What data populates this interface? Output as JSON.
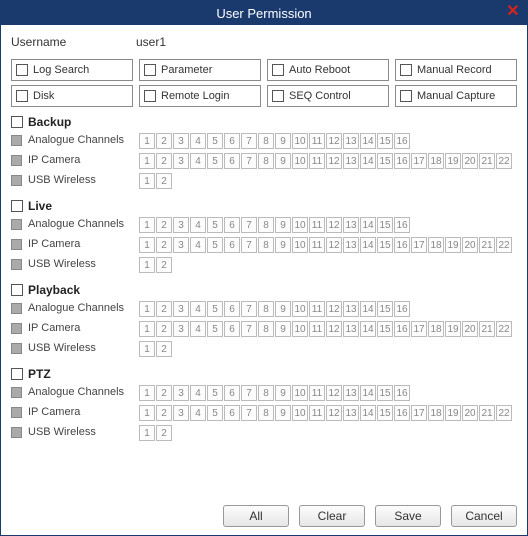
{
  "title": "User Permission",
  "username_label": "Username",
  "username_value": "user1",
  "perm_row1": [
    {
      "key": "log_search",
      "label": "Log Search"
    },
    {
      "key": "parameter",
      "label": "Parameter"
    },
    {
      "key": "auto_reboot",
      "label": "Auto Reboot"
    },
    {
      "key": "manual_record",
      "label": "Manual Record"
    }
  ],
  "perm_row2": [
    {
      "key": "disk",
      "label": "Disk"
    },
    {
      "key": "remote_login",
      "label": "Remote Login"
    },
    {
      "key": "seq_control",
      "label": "SEQ Control"
    },
    {
      "key": "manual_capture",
      "label": "Manual Capture"
    }
  ],
  "sections": [
    {
      "key": "backup",
      "title": "Backup",
      "rows": [
        {
          "key": "analogue",
          "label": "Analogue Channels",
          "count": 16
        },
        {
          "key": "ipcam",
          "label": "IP Camera",
          "count": 22
        },
        {
          "key": "usb",
          "label": "USB Wireless",
          "count": 2
        }
      ]
    },
    {
      "key": "live",
      "title": "Live",
      "rows": [
        {
          "key": "analogue",
          "label": "Analogue Channels",
          "count": 16
        },
        {
          "key": "ipcam",
          "label": "IP Camera",
          "count": 22
        },
        {
          "key": "usb",
          "label": "USB Wireless",
          "count": 2
        }
      ]
    },
    {
      "key": "playback",
      "title": "Playback",
      "rows": [
        {
          "key": "analogue",
          "label": "Analogue Channels",
          "count": 16
        },
        {
          "key": "ipcam",
          "label": "IP Camera",
          "count": 22
        },
        {
          "key": "usb",
          "label": "USB Wireless",
          "count": 2
        }
      ]
    },
    {
      "key": "ptz",
      "title": "PTZ",
      "rows": [
        {
          "key": "analogue",
          "label": "Analogue Channels",
          "count": 16
        },
        {
          "key": "ipcam",
          "label": "IP Camera",
          "count": 22
        },
        {
          "key": "usb",
          "label": "USB Wireless",
          "count": 2
        }
      ]
    }
  ],
  "buttons": {
    "all": "All",
    "clear": "Clear",
    "save": "Save",
    "cancel": "Cancel"
  }
}
